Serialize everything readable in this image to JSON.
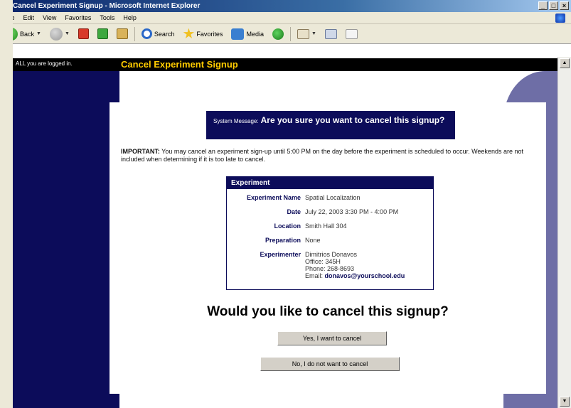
{
  "window": {
    "title": "Cancel Experiment Signup - Microsoft Internet Explorer",
    "controls": [
      "_",
      "□",
      "×"
    ]
  },
  "menu": [
    "File",
    "Edit",
    "View",
    "Favorites",
    "Tools",
    "Help"
  ],
  "toolbar": {
    "back_label": "Back",
    "search_label": "Search",
    "favorites_label": "Favorites",
    "media_label": "Media",
    "icons": [
      "back-icon",
      "forward-icon",
      "stop-icon",
      "refresh-icon",
      "home-icon",
      "search-icon",
      "favorites-icon",
      "media-icon",
      "history-icon",
      "mail-icon",
      "print-icon",
      "edit-icon"
    ]
  },
  "header": {
    "login_text": "ALL you are logged in.",
    "page_heading": "Cancel Experiment Signup"
  },
  "system_message": {
    "label": "System Message:",
    "text": "Are you sure you want to cancel this signup?"
  },
  "important": {
    "label": "IMPORTANT:",
    "text": " You may cancel an experiment sign-up until 5:00 PM on the day before the experiment is scheduled to occur. Weekends are not included when determining if it is too late to cancel."
  },
  "experiment": {
    "header": "Experiment",
    "rows": [
      {
        "key": "Experiment Name",
        "value": "Spatial Localization"
      },
      {
        "key": "Date",
        "value": "July 22, 2003 3:30 PM - 4:00 PM"
      },
      {
        "key": "Location",
        "value": "Smith Hall 304"
      },
      {
        "key": "Preparation",
        "value": "None"
      },
      {
        "key": "Experimenter",
        "lines": [
          "Dimitrios Donavos",
          "Office: 345H",
          "Phone: 268-8693"
        ],
        "email_label": "Email: ",
        "email": "donavos@yourschool.edu"
      }
    ]
  },
  "question": "Would you like to cancel this signup?",
  "buttons": {
    "yes": "Yes, I want to cancel",
    "no": "No, I do not want to cancel"
  },
  "colors": {
    "navy": "#0c0c5a",
    "heading_yellow": "#ffcc00",
    "curve": "#6e6ea6"
  }
}
